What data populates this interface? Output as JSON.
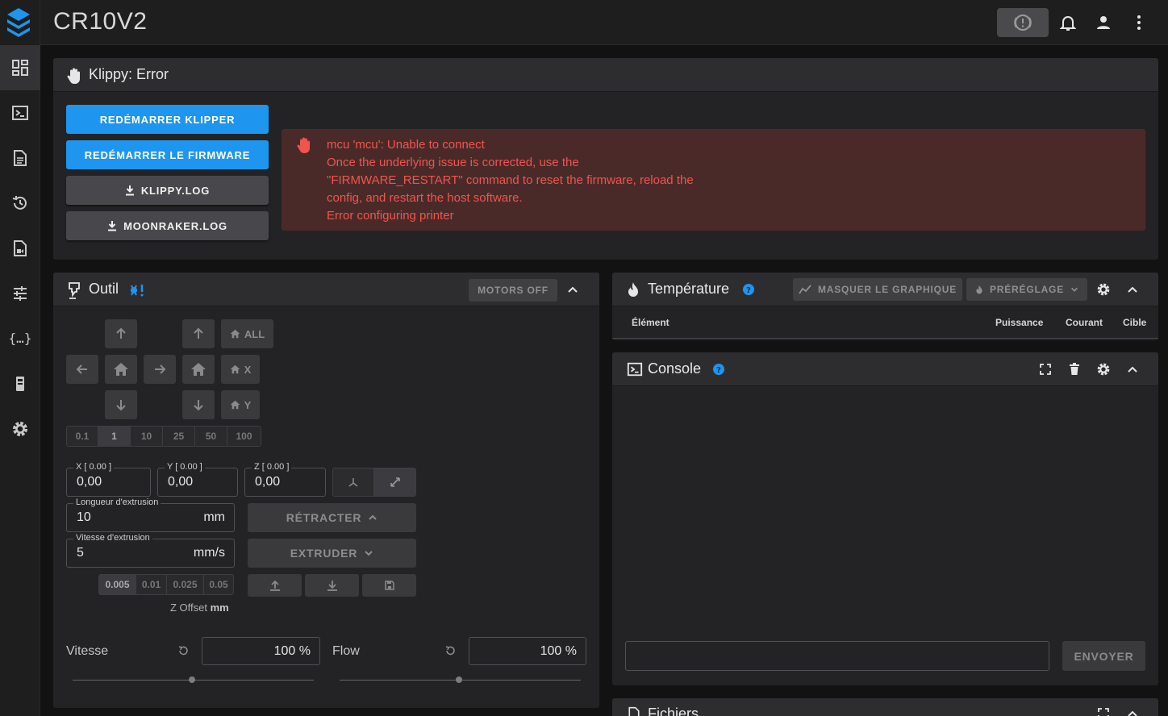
{
  "app": {
    "title": "CR10V2"
  },
  "sidebar": {
    "items": [
      {
        "name": "dashboard",
        "active": true
      },
      {
        "name": "console"
      },
      {
        "name": "files"
      },
      {
        "name": "history"
      },
      {
        "name": "gcode-viewer"
      },
      {
        "name": "tuning"
      },
      {
        "name": "macros"
      },
      {
        "name": "machine"
      },
      {
        "name": "settings"
      }
    ]
  },
  "klippy": {
    "title": "Klippy: Error",
    "buttons": {
      "restart_klipper": "REDÉMARRER KLIPPER",
      "restart_firmware": "REDÉMARRER LE FIRMWARE",
      "klippy_log": "KLIPPY.LOG",
      "moonraker_log": "MOONRAKER.LOG"
    },
    "error_lines": [
      "mcu 'mcu': Unable to connect",
      "Once the underlying issue is corrected, use the",
      "\"FIRMWARE_RESTART\" command to reset the firmware, reload the",
      "config, and restart the host software.",
      "Error configuring printer"
    ]
  },
  "tool": {
    "title": "Outil",
    "motors_off": "MOTORS OFF",
    "home_all": "ALL",
    "home_x": "X",
    "home_y": "Y",
    "steps": [
      "0.1",
      "1",
      "10",
      "25",
      "50",
      "100"
    ],
    "selected_step": "1",
    "position": {
      "x_label": "X [ 0.00 ]",
      "x_value": "0,00",
      "y_label": "Y [ 0.00 ]",
      "y_value": "0,00",
      "z_label": "Z [ 0.00 ]",
      "z_value": "0,00"
    },
    "extrude_length_label": "Longueur d'extrusion",
    "extrude_length_value": "10",
    "extrude_length_unit": "mm",
    "extrude_speed_label": "Vitesse d'extrusion",
    "extrude_speed_value": "5",
    "extrude_speed_unit": "mm/s",
    "retract": "RÉTRACTER",
    "extrude": "EXTRUDER",
    "z_steps": [
      "0.005",
      "0.01",
      "0.025",
      "0.05"
    ],
    "z_offset_label": "Z Offset",
    "z_offset_unit": "mm",
    "speed_label": "Vitesse",
    "speed_value": "100 %",
    "flow_label": "Flow",
    "flow_value": "100 %"
  },
  "temperature": {
    "title": "Température",
    "hide_chart": "MASQUER LE GRAPHIQUE",
    "presets": "PRÉRÉGLAGE",
    "columns": [
      "Élément",
      "Puissance",
      "Courant",
      "Cible"
    ]
  },
  "console": {
    "title": "Console",
    "input_placeholder": "",
    "send": "ENVOYER"
  },
  "files": {
    "title": "Fichiers"
  },
  "colors": {
    "accent": "#1e95ee",
    "error": "#f0544f",
    "error_bg": "#4a2a29"
  }
}
